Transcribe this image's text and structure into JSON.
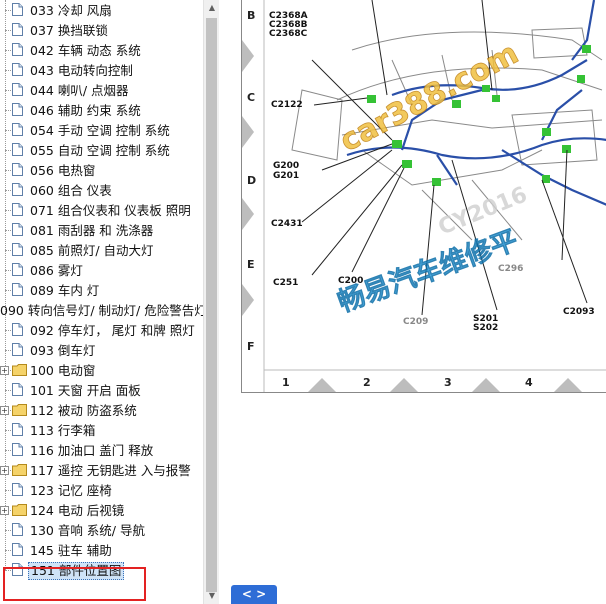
{
  "tree": {
    "items": [
      {
        "label": "033 冷却 风扇",
        "icon": "doc"
      },
      {
        "label": "037 换挡联锁",
        "icon": "doc"
      },
      {
        "label": "042 车辆 动态 系统",
        "icon": "doc"
      },
      {
        "label": "043 电动转向控制",
        "icon": "doc"
      },
      {
        "label": "044 喇叭/ 点烟器",
        "icon": "doc"
      },
      {
        "label": "046 辅助 约束 系统",
        "icon": "doc"
      },
      {
        "label": "054 手动 空调 控制 系统",
        "icon": "doc"
      },
      {
        "label": "055 自动 空调 控制 系统",
        "icon": "doc"
      },
      {
        "label": "056 电热窗",
        "icon": "doc"
      },
      {
        "label": "060 组合 仪表",
        "icon": "doc"
      },
      {
        "label": "071 组合仪表和 仪表板 照明",
        "icon": "doc"
      },
      {
        "label": "081 雨刮器 和 洗涤器",
        "icon": "doc"
      },
      {
        "label": "085 前照灯/ 自动大灯",
        "icon": "doc"
      },
      {
        "label": "086 雾灯",
        "icon": "doc"
      },
      {
        "label": "089 车内 灯",
        "icon": "doc"
      },
      {
        "label": "090 转向信号灯/ 制动灯/ 危险警告灯",
        "icon": "folder-open"
      },
      {
        "label": "092 停车灯， 尾灯 和牌 照灯",
        "icon": "doc"
      },
      {
        "label": "093 倒车灯",
        "icon": "doc"
      },
      {
        "label": "100 电动窗",
        "icon": "folder"
      },
      {
        "label": "101 天窗 开启 面板",
        "icon": "doc"
      },
      {
        "label": "112 被动 防盗系统",
        "icon": "folder"
      },
      {
        "label": "113 行李箱",
        "icon": "doc"
      },
      {
        "label": "116 加油口 盖门 释放",
        "icon": "doc"
      },
      {
        "label": "117 遥控 无钥匙进 入与报警",
        "icon": "folder"
      },
      {
        "label": "123 记忆 座椅",
        "icon": "doc"
      },
      {
        "label": "124 电动 后视镜",
        "icon": "folder"
      },
      {
        "label": "130 音响 系统/ 导航",
        "icon": "doc"
      },
      {
        "label": "145 驻车 辅助",
        "icon": "doc"
      },
      {
        "label": "151 部件位置图",
        "icon": "doc",
        "selected": true
      }
    ]
  },
  "diagram": {
    "zones": [
      "B",
      "C",
      "D",
      "E",
      "F"
    ],
    "columns": [
      "1",
      "2",
      "3",
      "4"
    ],
    "connectors": {
      "c2368": [
        "C2368A",
        "C2368B",
        "C2368C"
      ],
      "c2122": "C2122",
      "g200": "G200",
      "g201": "G201",
      "c2431": "C2431",
      "c251": "C251",
      "c200": "C200",
      "c209": "C209",
      "s201": "S201",
      "s202": "S202",
      "c296": "C296",
      "c2093": "C2093"
    },
    "watermarks": {
      "url": "car388.com",
      "site": "畅易汽车维修平",
      "code": "CY2016"
    }
  },
  "nav": {
    "label": "< >"
  },
  "colors": {
    "accent": "#2e6dd6",
    "highlight": "#e32222",
    "wire": "#2a4fa8",
    "connector": "#35c235"
  }
}
